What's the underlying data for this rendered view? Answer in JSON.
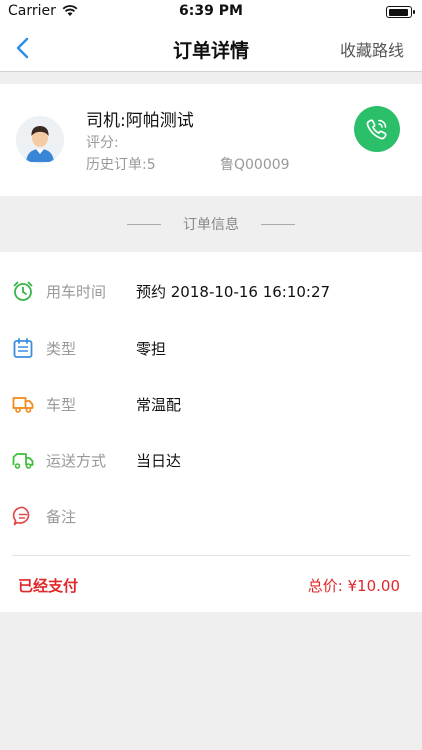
{
  "status_bar": {
    "carrier": "Carrier",
    "time": "6:39 PM"
  },
  "nav": {
    "title": "订单详情",
    "right_action": "收藏路线"
  },
  "driver": {
    "name": "司机:阿帕测试",
    "rating_label": "评分:",
    "history_orders": "历史订单:5",
    "plate": "鲁Q00009"
  },
  "section": {
    "title": "订单信息"
  },
  "order_info": {
    "rows": [
      {
        "icon": "alarm-clock-icon",
        "label": "用车时间",
        "value": "预约 2018-10-16 16:10:27"
      },
      {
        "icon": "calendar-icon",
        "label": "类型",
        "value": "零担"
      },
      {
        "icon": "truck-icon",
        "label": "车型",
        "value": "常温配"
      },
      {
        "icon": "delivery-truck-icon",
        "label": "运送方式",
        "value": "当日达"
      },
      {
        "icon": "chat-bubble-icon",
        "label": "备注",
        "value": ""
      }
    ]
  },
  "summary": {
    "payment_status": "已经支付",
    "total": "总价: ¥10.00"
  },
  "colors": {
    "accent_blue": "#2a8ee8",
    "call_green": "#2bbf6a",
    "alert_red": "#e0282b",
    "clock_green": "#38b548",
    "calendar_blue": "#3b8ee0",
    "truck_orange": "#f28a1c",
    "delivery_green": "#3fbf3a",
    "chat_red": "#e04a4a"
  }
}
